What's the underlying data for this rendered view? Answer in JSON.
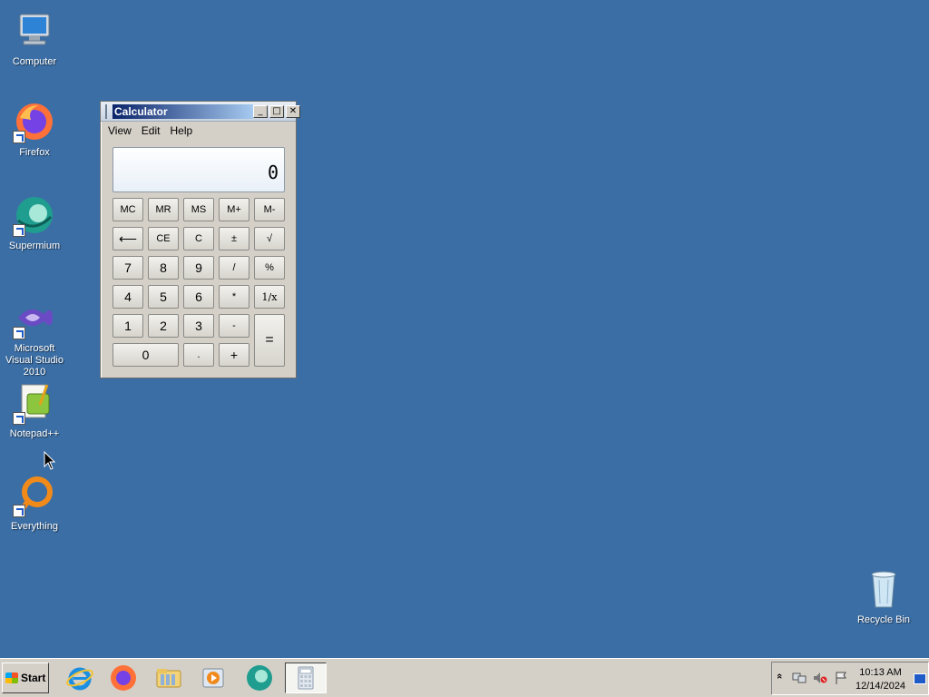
{
  "desktop": {
    "icons": [
      {
        "label": "Computer"
      },
      {
        "label": "Firefox"
      },
      {
        "label": "Supermium"
      },
      {
        "label": "Microsoft Visual Studio 2010"
      },
      {
        "label": "Notepad++"
      },
      {
        "label": "Everything"
      },
      {
        "label": "Recycle Bin"
      }
    ]
  },
  "calculator": {
    "title": "Calculator",
    "window_buttons": {
      "minimize": "_",
      "maximize": "□",
      "close": "✕"
    },
    "menu": [
      "View",
      "Edit",
      "Help"
    ],
    "display": "0",
    "keys": {
      "mc": "MC",
      "mr": "MR",
      "ms": "MS",
      "mplus": "M+",
      "mminus": "M-",
      "back": "⟵",
      "ce": "CE",
      "c": "C",
      "plusminus": "±",
      "sqrt": "√",
      "k7": "7",
      "k8": "8",
      "k9": "9",
      "div": "/",
      "pct": "%",
      "k4": "4",
      "k5": "5",
      "k6": "6",
      "mul": "*",
      "recip": "1/x",
      "k1": "1",
      "k2": "2",
      "k3": "3",
      "sub": "-",
      "eq": "=",
      "k0": "0",
      "dot": ".",
      "add": "+"
    }
  },
  "taskbar": {
    "start_label": "Start",
    "apps": [
      "internet-explorer",
      "firefox",
      "file-explorer",
      "media-player",
      "supermium",
      "calculator"
    ],
    "active_app": "calculator",
    "tray": {
      "time": "10:13 AM",
      "date": "12/14/2024",
      "expand": "«"
    }
  },
  "colors": {
    "desktop": "#3b6ea5",
    "taskbar": "#d4d0c8"
  }
}
